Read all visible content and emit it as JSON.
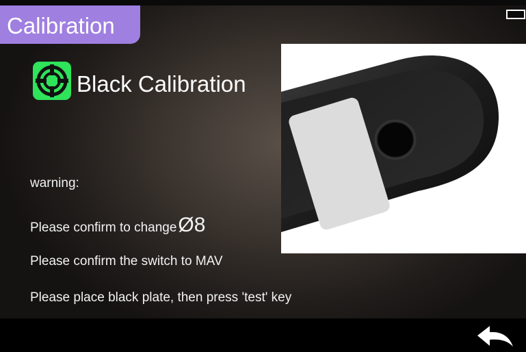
{
  "header": {
    "title": "Calibration",
    "battery_icon": "battery-icon"
  },
  "main": {
    "heading_icon": "calibration-target-icon",
    "heading": "Black Calibration",
    "photo_icon": "black-calibration-plate-photo",
    "warning_label": "warning:",
    "line1_text": "Please confirm to change",
    "line1_value": "Ø8",
    "line2": "Please confirm the switch to  MAV",
    "line3": "Please place black plate, then press 'test' key"
  },
  "footer": {
    "back_icon": "back-arrow-icon"
  },
  "colors": {
    "tab": "#9f7fe0",
    "icon_green": "#2fe35a"
  }
}
